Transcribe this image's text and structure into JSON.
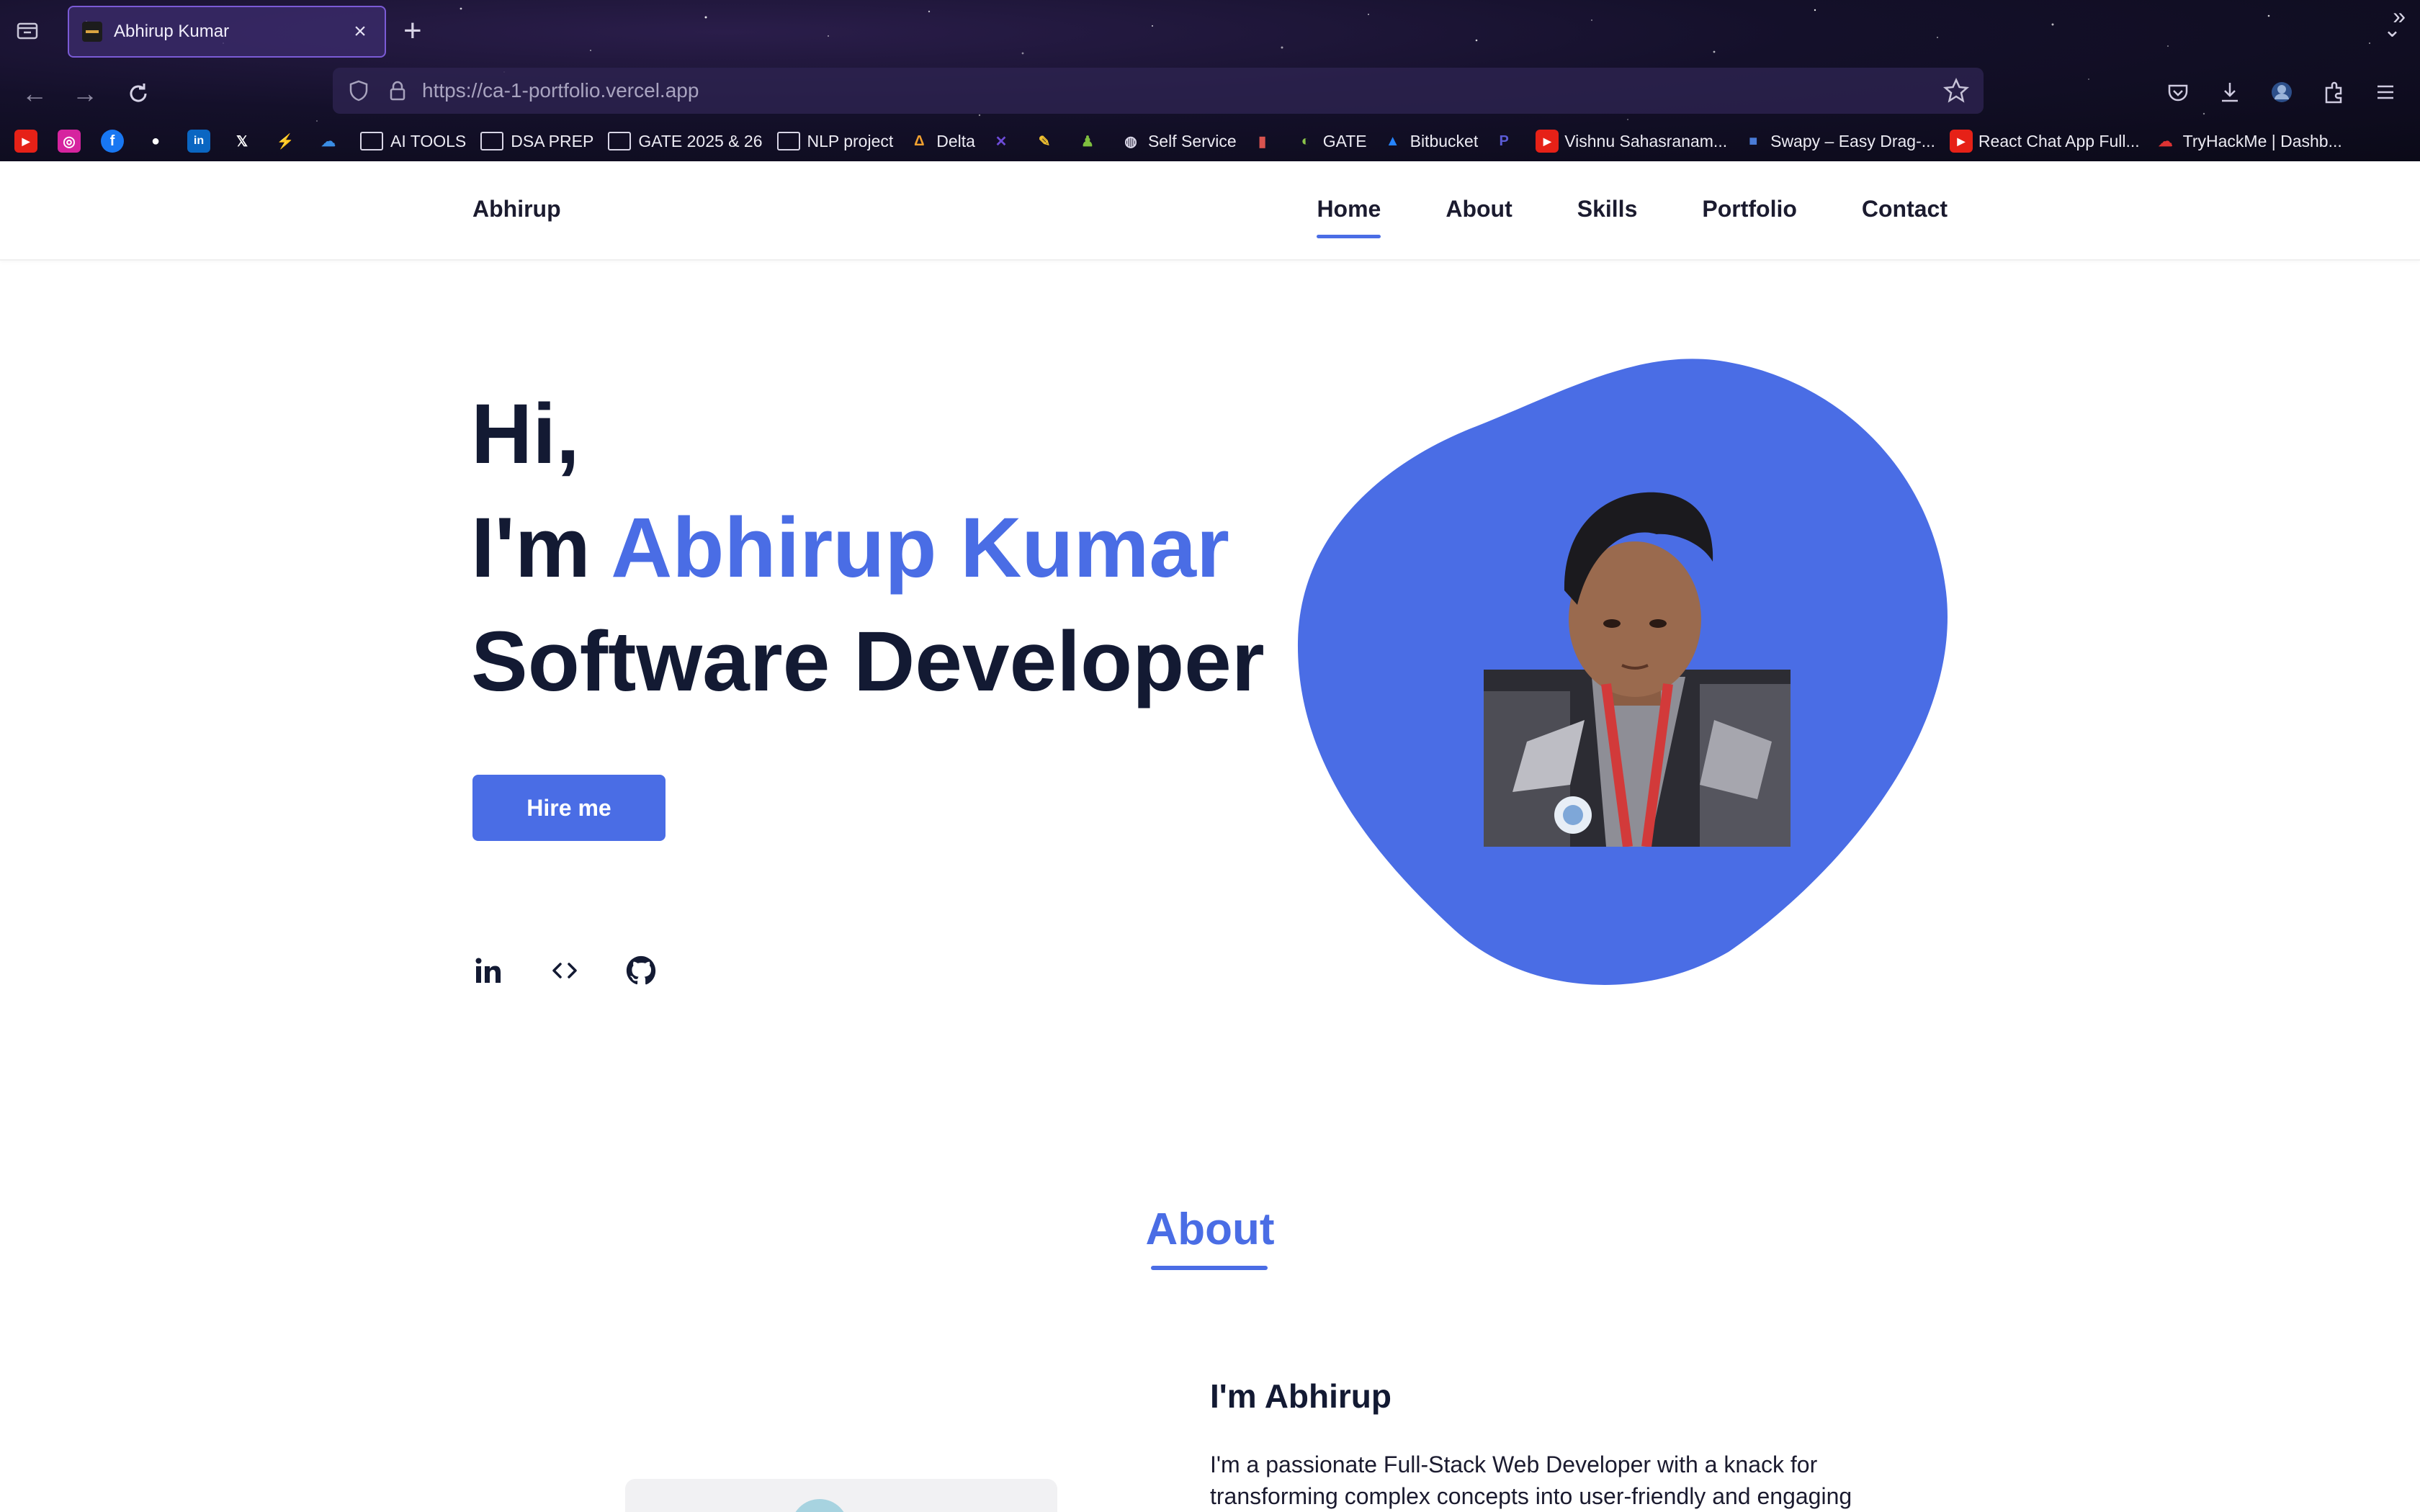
{
  "browser": {
    "tab_title": "Abhirup Kumar",
    "url": "https://ca-1-portfolio.vercel.app",
    "bookmarks": [
      {
        "label": "",
        "icon": "youtube-icon",
        "color": "#e62117"
      },
      {
        "label": "",
        "icon": "instagram-icon",
        "color": "#d6249f"
      },
      {
        "label": "",
        "icon": "facebook-icon",
        "color": "#1877f2"
      },
      {
        "label": "",
        "icon": "github-icon",
        "color": "#ffffff"
      },
      {
        "label": "",
        "icon": "linkedin-icon",
        "color": "#0a66c2"
      },
      {
        "label": "",
        "icon": "x-icon",
        "color": "#ffffff"
      },
      {
        "label": "",
        "icon": "bolt-icon",
        "color": "#f2a541"
      },
      {
        "label": "",
        "icon": "onedrive-icon",
        "color": "#3a8ee6"
      },
      {
        "label": "AI TOOLS",
        "icon": "folder-icon"
      },
      {
        "label": "DSA PREP",
        "icon": "folder-icon"
      },
      {
        "label": "GATE 2025 & 26",
        "icon": "folder-icon"
      },
      {
        "label": "NLP project",
        "icon": "folder-icon"
      },
      {
        "label": "Delta",
        "icon": "delta-icon",
        "color": "#f0a030"
      },
      {
        "label": "",
        "icon": "tools-icon",
        "color": "#6d4bd8"
      },
      {
        "label": "",
        "icon": "pencil-icon",
        "color": "#f2c230"
      },
      {
        "label": "",
        "icon": "chess-icon",
        "color": "#7fbf3f"
      },
      {
        "label": "Self Service",
        "icon": "globe-icon"
      },
      {
        "label": "",
        "icon": "books-icon",
        "color": "#d9534f"
      },
      {
        "label": "GATE",
        "icon": "gate-icon",
        "color": "#8bc34a"
      },
      {
        "label": "Bitbucket",
        "icon": "bitbucket-icon",
        "color": "#2684ff"
      },
      {
        "label": "",
        "icon": "p-icon",
        "color": "#5b5bd6"
      },
      {
        "label": "Vishnu Sahasranam...",
        "icon": "youtube-icon",
        "color": "#e62117"
      },
      {
        "label": "Swapy – Easy Drag-...",
        "icon": "swapy-icon",
        "color": "#4a7bd6"
      },
      {
        "label": "React Chat App Full...",
        "icon": "youtube-icon",
        "color": "#e62117"
      },
      {
        "label": "TryHackMe | Dashb...",
        "icon": "tryhackme-icon",
        "color": "#d33"
      }
    ]
  },
  "site": {
    "brand": "Abhirup",
    "nav": [
      "Home",
      "About",
      "Skills",
      "Portfolio",
      "Contact"
    ],
    "active_nav": "Home",
    "hero": {
      "greeting": "Hi,",
      "prefix": "I'm ",
      "name": "Abhirup Kumar",
      "role": "Software Developer",
      "cta": "Hire me"
    },
    "socials": [
      "linkedin-icon",
      "code-icon",
      "github-icon"
    ],
    "about": {
      "title": "About",
      "subtitle": "I'm Abhirup",
      "paragraph": "I'm a passionate Full-Stack Web Developer with a knack for transforming complex concepts into user-friendly and engaging"
    }
  },
  "colors": {
    "accent": "#4a6de5",
    "heading": "#131a33"
  }
}
